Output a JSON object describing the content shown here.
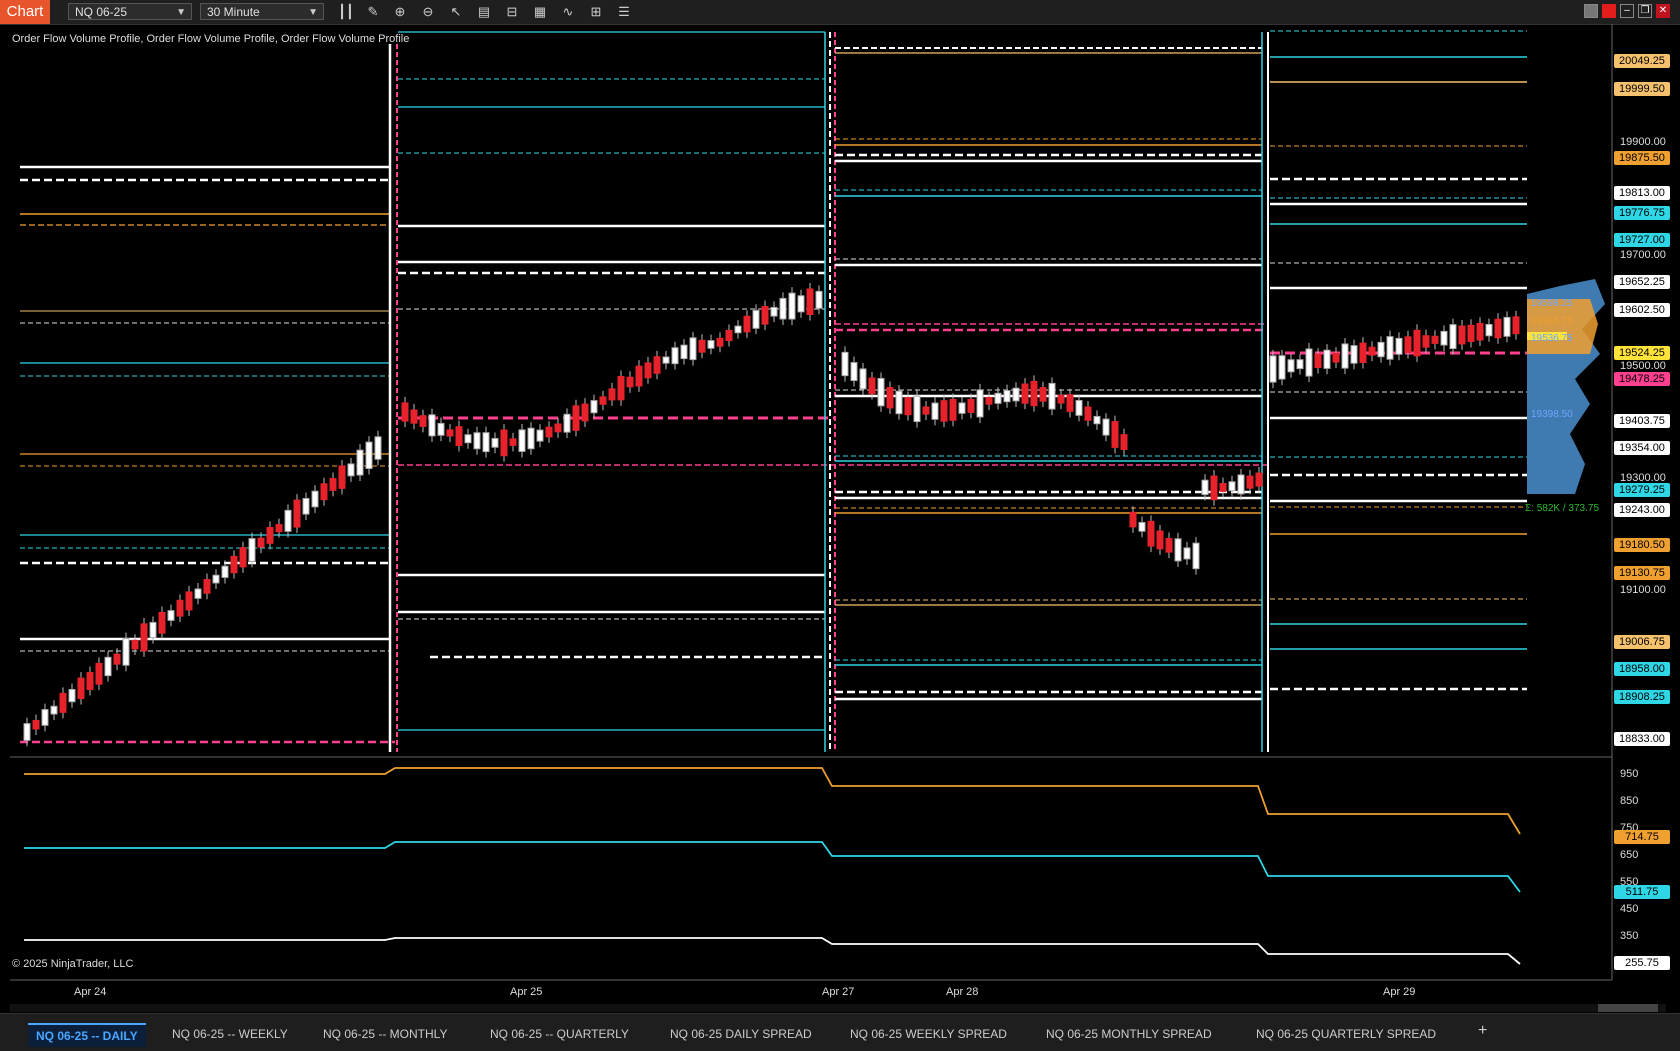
{
  "toolbar": {
    "chart_tab": "Chart",
    "instrument": "NQ 06-25",
    "timeframe": "30 Minute",
    "tools": [
      "bar-type-icon",
      "pencil-icon",
      "zoom-in-icon",
      "zoom-out-icon",
      "pointer-icon",
      "data-box-icon",
      "chart-trader-icon",
      "properties-icon",
      "indicators-icon",
      "strategies-icon",
      "list-icon"
    ]
  },
  "chart": {
    "indicator_label": "Order Flow Volume Profile, Order Flow Volume Profile, Order Flow Volume Profile",
    "copyright": "© 2025 NinjaTrader, LLC",
    "price_axis_labels": [
      "19900.00",
      "19700.00",
      "19500.00",
      "19300.00",
      "19100.00"
    ],
    "price_tags": [
      {
        "value": "20049.25",
        "color": "#f5c16c"
      },
      {
        "value": "19999.50",
        "color": "#f5c16c"
      },
      {
        "value": "19875.50",
        "color": "#f0a030"
      },
      {
        "value": "19813.00",
        "color": "#ffffff"
      },
      {
        "value": "19776.75",
        "color": "#2fd6e6"
      },
      {
        "value": "19727.00",
        "color": "#2fd6e6"
      },
      {
        "value": "19652.25",
        "color": "#ffffff"
      },
      {
        "value": "19602.50",
        "color": "#ffffff"
      },
      {
        "value": "19524.25",
        "color": "#ffe23a"
      },
      {
        "value": "19478.25",
        "color": "#ff3f8f"
      },
      {
        "value": "19403.75",
        "color": "#ffffff"
      },
      {
        "value": "19354.00",
        "color": "#ffffff"
      },
      {
        "value": "19279.25",
        "color": "#2fd6e6"
      },
      {
        "value": "19243.00",
        "color": "#ffffff"
      },
      {
        "value": "19180.50",
        "color": "#f0a030"
      },
      {
        "value": "19130.75",
        "color": "#f0a030"
      },
      {
        "value": "19006.75",
        "color": "#f5c16c"
      },
      {
        "value": "18958.00",
        "color": "#2fd6e6"
      },
      {
        "value": "18908.25",
        "color": "#2fd6e6"
      },
      {
        "value": "18833.00",
        "color": "#ffffff"
      }
    ],
    "profile_labels": [
      "19598.25",
      "19566.75",
      "19536.75",
      "19398.50",
      "Σ: 582K / 373.75"
    ],
    "lower_axis_labels": [
      "950",
      "850",
      "750",
      "650",
      "550",
      "450",
      "350"
    ],
    "lower_tags": [
      {
        "value": "714.75",
        "color": "#f0a030"
      },
      {
        "value": "511.75",
        "color": "#2fd6e6"
      },
      {
        "value": "255.75",
        "color": "#ffffff"
      }
    ],
    "date_labels": [
      "Apr 24",
      "Apr 25",
      "Apr 27",
      "Apr 28",
      "Apr 29"
    ]
  },
  "tabs": [
    {
      "label": "NQ 06-25 -- DAILY",
      "active": true
    },
    {
      "label": "NQ 06-25 -- WEEKLY",
      "active": false
    },
    {
      "label": "NQ 06-25 -- MONTHLY",
      "active": false
    },
    {
      "label": "NQ 06-25 -- QUARTERLY",
      "active": false
    },
    {
      "label": "NQ 06-25 DAILY SPREAD",
      "active": false
    },
    {
      "label": "NQ 06-25 WEEKLY SPREAD",
      "active": false
    },
    {
      "label": "NQ 06-25 MONTHLY SPREAD",
      "active": false
    },
    {
      "label": "NQ 06-25 QUARTERLY SPREAD",
      "active": false
    }
  ],
  "add_tab": "+"
}
